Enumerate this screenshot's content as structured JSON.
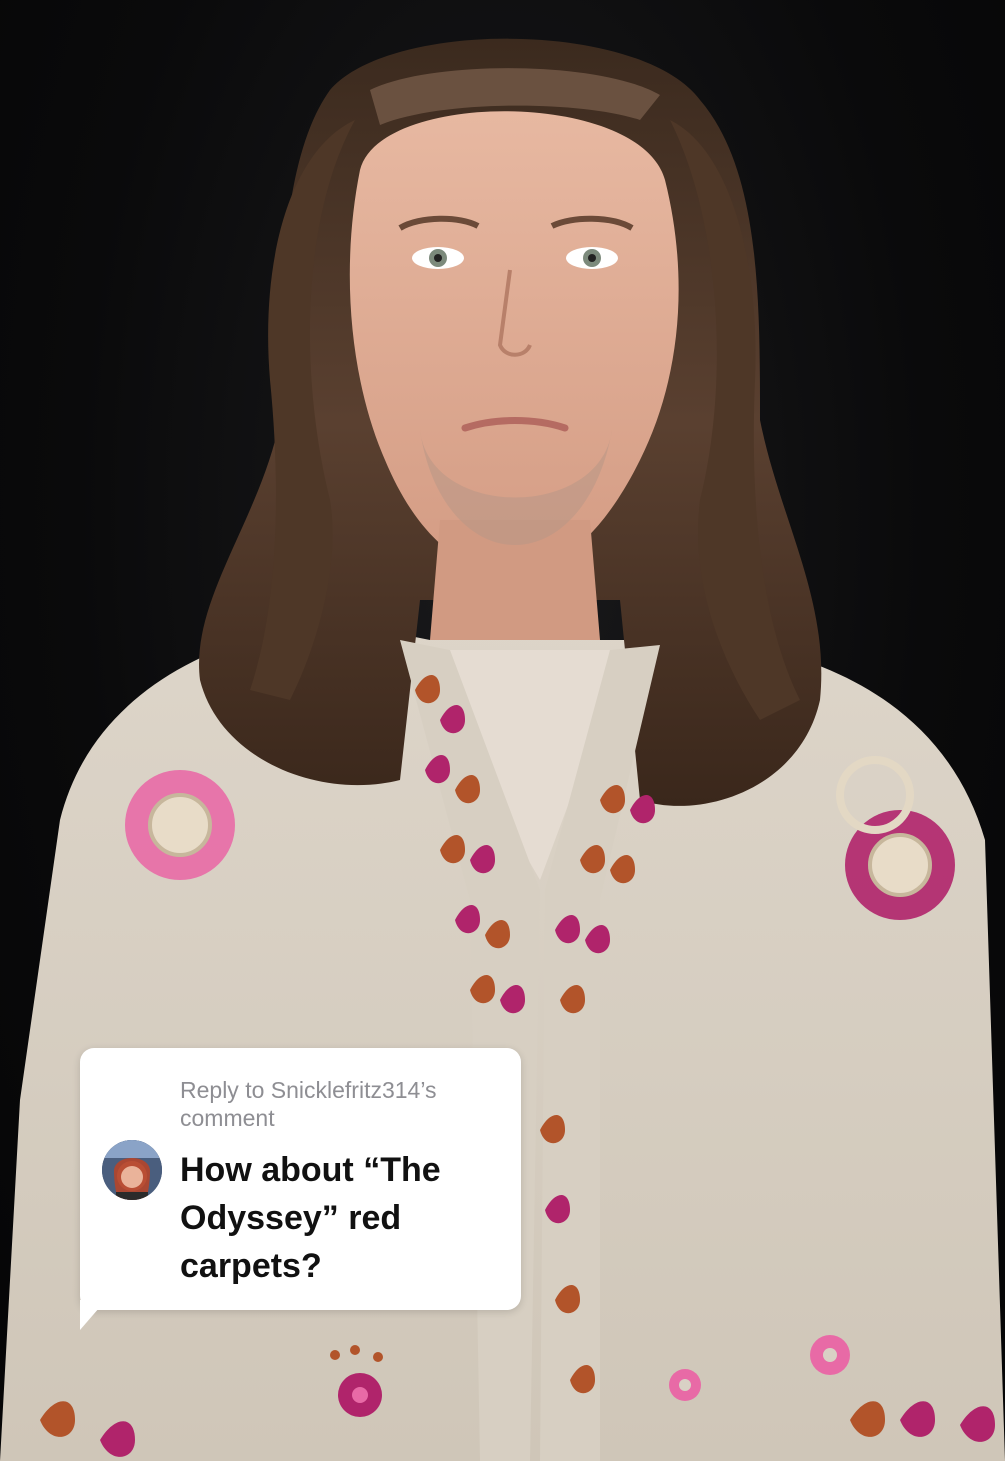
{
  "reply_card": {
    "header_line1": "Reply to Snicklefritz314’s",
    "header_line2": "comment",
    "comment_line1": "How about “The",
    "comment_line2": "Odyssey” red",
    "comment_line3": "carpets?"
  },
  "colors": {
    "background": "#0b0b0c",
    "card": "#ffffff",
    "header_text": "#8e8e93",
    "comment_text": "#111111",
    "sweater": "#d9d1c5",
    "hair": "#4a3424",
    "embroidery_pink": "#e86aa6",
    "embroidery_magenta": "#b0246b",
    "embroidery_rust": "#b2542a"
  },
  "icons": {
    "avatar": "commenter-avatar-icon"
  }
}
